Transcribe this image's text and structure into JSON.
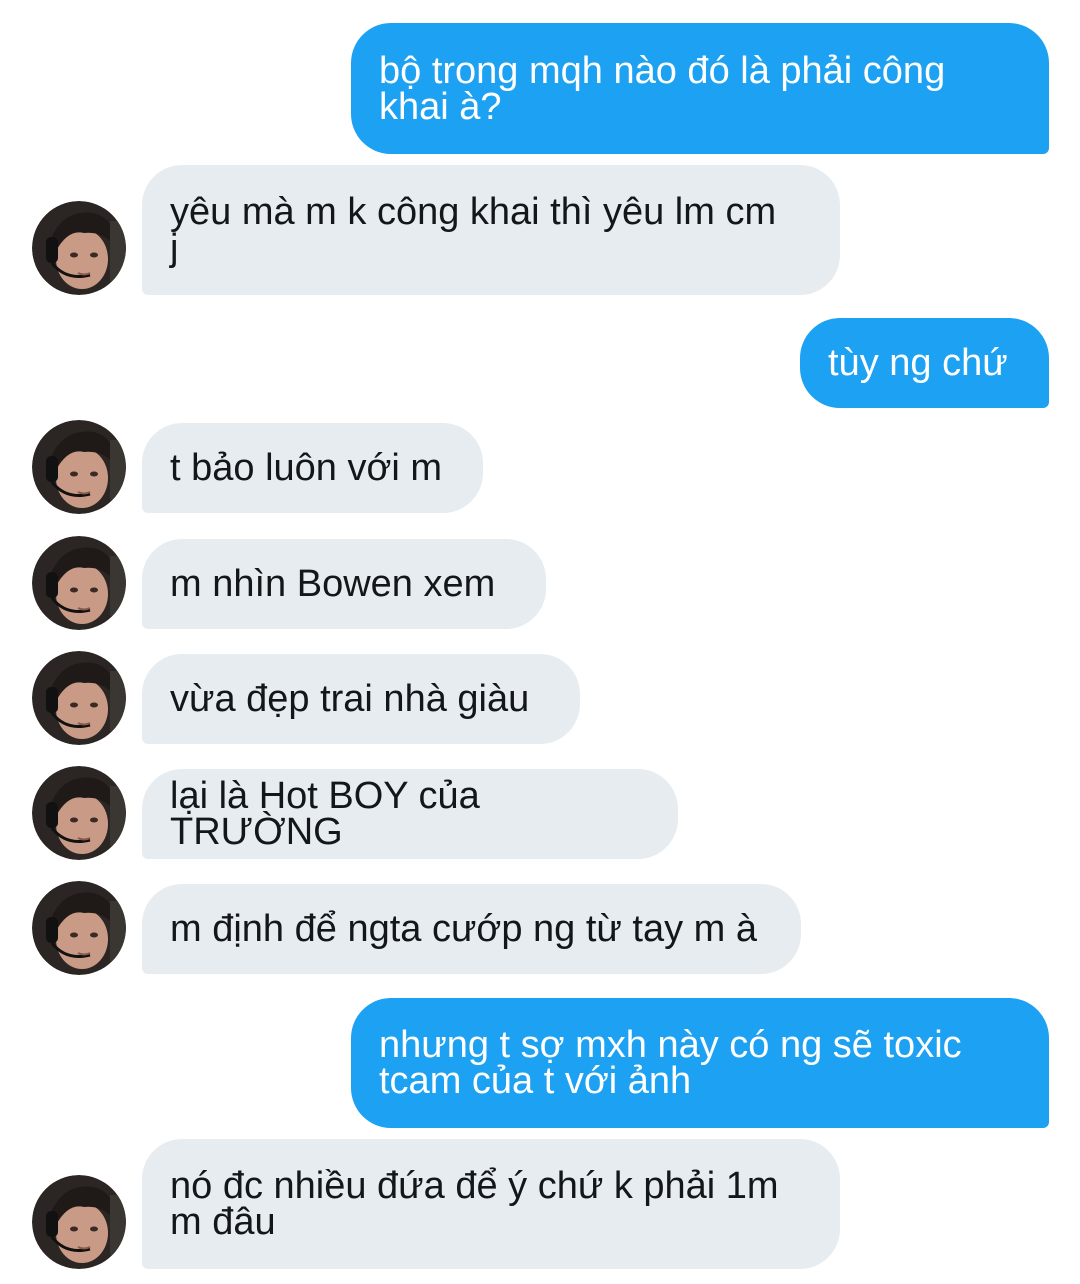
{
  "colors": {
    "sent_bubble": "#1da1f2",
    "received_bubble": "#e6ecf0",
    "sent_text": "#ffffff",
    "received_text": "#14171a"
  },
  "conversation": {
    "messages": [
      {
        "direction": "outgoing",
        "text": "bộ trong mqh nào đó là phải công\nkhai à?"
      },
      {
        "direction": "incoming",
        "avatar": "user-avatar-icon",
        "text": "yêu mà m k công khai thì yêu lm cm\nj"
      },
      {
        "direction": "outgoing",
        "text": "tùy ng chứ"
      },
      {
        "direction": "incoming",
        "avatar": "user-avatar-icon",
        "text": "t bảo luôn với m"
      },
      {
        "direction": "incoming",
        "avatar": "user-avatar-icon",
        "text": "m nhìn Bowen xem"
      },
      {
        "direction": "incoming",
        "avatar": "user-avatar-icon",
        "text": "vừa đẹp trai nhà giàu"
      },
      {
        "direction": "incoming",
        "avatar": "user-avatar-icon",
        "text": "lại là Hot BOY của TRƯỜNG"
      },
      {
        "direction": "incoming",
        "avatar": "user-avatar-icon",
        "text": "m định để ngta cướp ng từ tay m à"
      },
      {
        "direction": "outgoing",
        "text": "nhưng t sợ mxh này có ng sẽ toxic\ntcam của t với ảnh"
      },
      {
        "direction": "incoming",
        "avatar": "user-avatar-icon",
        "text": "nó đc nhiều đứa để ý chứ k phải 1m\nm đâu"
      }
    ]
  }
}
